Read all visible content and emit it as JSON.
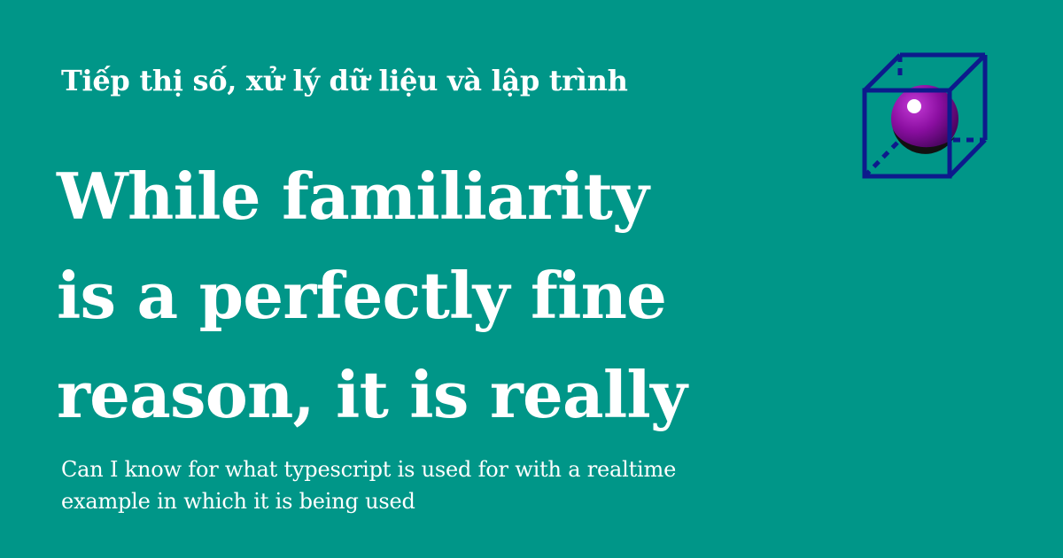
{
  "site": {
    "title": "Tiếp thị số, xử lý dữ liệu và lập trình",
    "logo_icon": "cube-sphere-icon"
  },
  "post": {
    "headline_lines": [
      "While familiarity",
      "is a perfectly fine",
      "reason, it is really"
    ],
    "description_lines": [
      "Can I know for what typescript is used for with a realtime",
      "example in which it is being used"
    ]
  },
  "colors": {
    "background": "#009688",
    "text": "#ffffff",
    "cube_stroke": "#0d1a8c",
    "sphere": "#8a0ea0"
  }
}
